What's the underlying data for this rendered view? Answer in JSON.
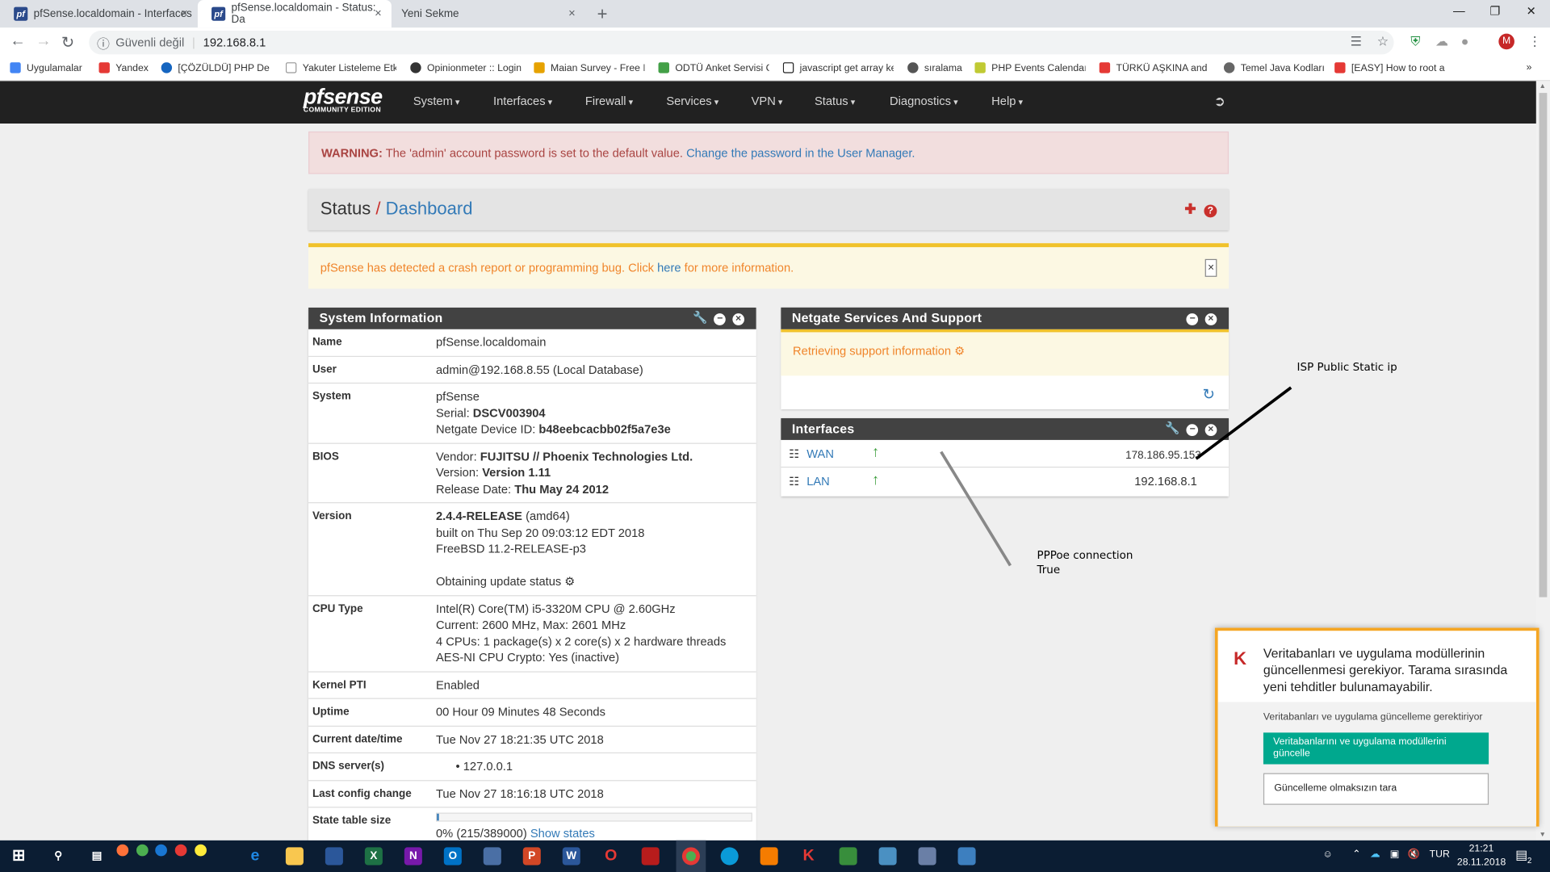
{
  "browser": {
    "tabs": [
      {
        "title": "pfSense.localdomain - Interfaces",
        "fav": "pf",
        "close": "×"
      },
      {
        "title": "pfSense.localdomain - Status: Da",
        "fav": "pf",
        "close": "×"
      },
      {
        "title": "Yeni Sekme",
        "fav": "",
        "close": "×"
      }
    ],
    "new_tab": "+",
    "security_label": "Güvenli değil",
    "url": "192.168.8.1",
    "avatar": "M",
    "bookmarks": [
      {
        "label": "Uygulamalar",
        "color": "#4285f4"
      },
      {
        "label": "Yandex",
        "color": "#e53935"
      },
      {
        "label": "[ÇÖZÜLDÜ] PHP De (",
        "color": "#1565c0"
      },
      {
        "label": "Yakuter Listeleme Etk",
        "color": "#9e9e9e"
      },
      {
        "label": "Opinionmeter :: Login",
        "color": "#333333"
      },
      {
        "label": "Maian Survey - Free I",
        "color": "#e6a200"
      },
      {
        "label": "ODTÜ Anket Servisi C",
        "color": "#43a047"
      },
      {
        "label": "javascript get array ke",
        "color": "#222222"
      },
      {
        "label": "sıralama",
        "color": "#555555"
      },
      {
        "label": "PHP Events Calendar",
        "color": "#c0ca33"
      },
      {
        "label": "TÜRKÜ AŞKINA and ",
        "color": "#e53935"
      },
      {
        "label": "Temel Java Kodları",
        "color": "#666666"
      },
      {
        "label": "[EASY] How to root a",
        "color": "#e53935"
      }
    ],
    "more": "»"
  },
  "nav": {
    "logo": "pfsense",
    "logo_sub": "COMMUNITY EDITION",
    "items": [
      "System",
      "Interfaces",
      "Firewall",
      "Services",
      "VPN",
      "Status",
      "Diagnostics",
      "Help"
    ]
  },
  "warning": {
    "prefix": "WARNING:",
    "text": "The 'admin' account password is set to the default value.",
    "link": "Change the password in the User Manager."
  },
  "breadcrumb": {
    "root": "Status",
    "sep": "/",
    "current": "Dashboard"
  },
  "crash": {
    "text1": "pfSense has detected a crash report or programming bug. Click",
    "link": "here",
    "text2": "for more information.",
    "close": "×"
  },
  "system_info": {
    "title": "System Information",
    "rows": [
      {
        "key": "Name",
        "lines": [
          "pfSense.localdomain"
        ]
      },
      {
        "key": "User",
        "lines": [
          "admin@192.168.8.55 (Local Database)"
        ]
      },
      {
        "key": "System",
        "lines": [
          "pfSense"
        ],
        "bold_pairs": [
          [
            "Serial: ",
            "DSCV003904"
          ],
          [
            "Netgate Device ID: ",
            "b48eebcacbb02f5a7e3e"
          ]
        ]
      },
      {
        "key": "BIOS",
        "bold_pairs": [
          [
            "Vendor: ",
            "FUJITSU // Phoenix Technologies Ltd."
          ],
          [
            "Version: ",
            "Version 1.11"
          ],
          [
            "Release Date: ",
            "Thu May 24 2012"
          ]
        ]
      },
      {
        "key": "Version",
        "version_bold": "2.4.4-RELEASE",
        "version_rest": " (amd64)",
        "lines": [
          "built on Thu Sep 20 09:03:12 EDT 2018",
          "FreeBSD 11.2-RELEASE-p3",
          "",
          "Obtaining update status ⚙"
        ]
      },
      {
        "key": "CPU Type",
        "lines": [
          "Intel(R) Core(TM) i5-3320M CPU @ 2.60GHz",
          "Current: 2600 MHz, Max: 2601 MHz",
          "4 CPUs: 1 package(s) x 2 core(s) x 2 hardware threads",
          "AES-NI CPU Crypto: Yes (inactive)"
        ]
      },
      {
        "key": "Kernel PTI",
        "lines": [
          "Enabled"
        ]
      },
      {
        "key": "Uptime",
        "lines": [
          "00 Hour 09 Minutes 48 Seconds"
        ]
      },
      {
        "key": "Current date/time",
        "lines": [
          "Tue Nov 27 18:21:35 UTC 2018"
        ]
      },
      {
        "key": "DNS server(s)",
        "lines": [
          "• 127.0.0.1"
        ]
      },
      {
        "key": "Last config change",
        "lines": [
          "Tue Nov 27 18:16:18 UTC 2018"
        ]
      }
    ],
    "state_table": {
      "key": "State table size",
      "text": "0% (215/389000)",
      "link": "Show states",
      "fill_fraction": 0.0006
    }
  },
  "netgate": {
    "title": "Netgate Services And Support",
    "text": "Retrieving support information"
  },
  "interfaces": {
    "title": "Interfaces",
    "rows": [
      {
        "name": "WAN",
        "ip": "178.186.95.153"
      },
      {
        "name": "LAN",
        "ip": "192.168.8.1"
      }
    ]
  },
  "annotations": {
    "isp": "ISP Public Static ip",
    "pppoe1": "PPPoe connection",
    "pppoe2": "True"
  },
  "kaspersky": {
    "message": "Veritabanları ve uygulama modüllerinin güncellenmesi gerekiyor. Tarama sırasında yeni tehditler bulunamayabilir.",
    "sub": "Veritabanları ve uygulama güncelleme gerektiriyor",
    "btn_update": "Veritabanlarını ve uygulama modüllerini güncelle",
    "btn_skip": "Güncelleme olmaksızın tara"
  },
  "taskbar": {
    "lang": "TUR",
    "time": "21:21",
    "date": "28.11.2018",
    "notif_count": "2"
  }
}
